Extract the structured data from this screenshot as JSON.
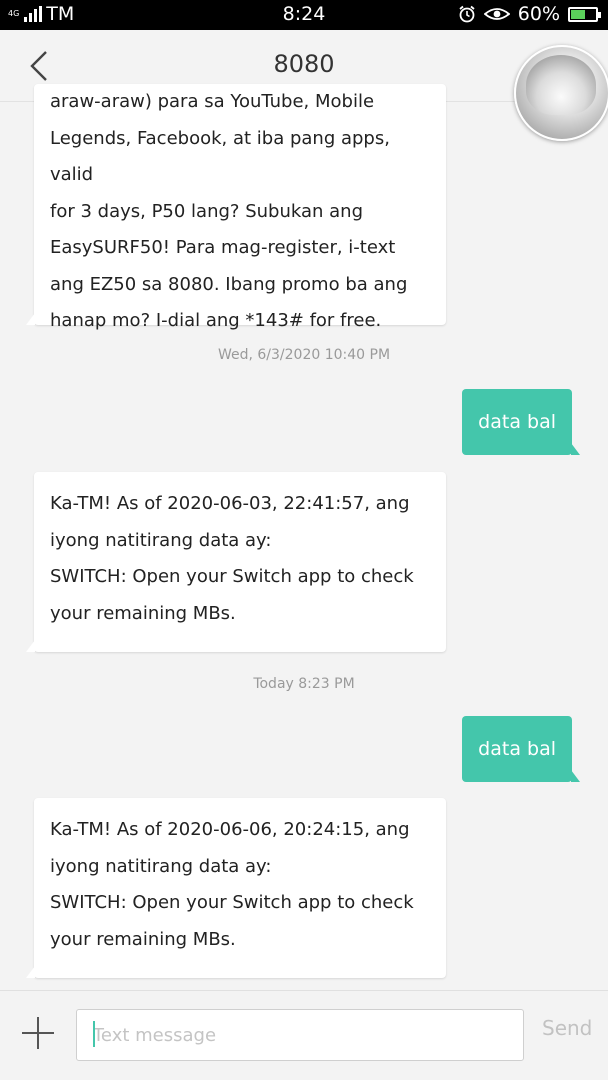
{
  "status_bar": {
    "network_type": "4G",
    "carrier": "TM",
    "time": "8:24",
    "battery": "60%",
    "battery_level": 0.6,
    "icons": [
      "alarm-icon",
      "eye-comfort-icon",
      "battery-icon"
    ]
  },
  "header": {
    "title": "8080",
    "back_icon": "chevron-left-icon"
  },
  "messages": [
    {
      "direction": "incoming",
      "text": "araw-araw) para sa YouTube, Mobile\nLegends, Facebook, at iba pang apps, valid\nfor 3 days, P50 lang? Subukan ang\nEasySURF50! Para mag-register, i-text\nang EZ50 sa 8080. Ibang promo ba ang\nhanap mo? I-dial ang *143# for free."
    },
    {
      "type": "timestamp",
      "text": "Wed, 6/3/2020 10:40 PM"
    },
    {
      "direction": "outgoing",
      "text": "data bal"
    },
    {
      "direction": "incoming",
      "text": "Ka-TM! As of 2020-06-03, 22:41:57, ang\niyong natitirang data ay:\nSWITCH: Open your Switch app to check\nyour remaining MBs."
    },
    {
      "type": "timestamp",
      "text": "Today 8:23 PM"
    },
    {
      "direction": "outgoing",
      "text": "data bal"
    },
    {
      "direction": "incoming",
      "text": "Ka-TM! As of 2020-06-06, 20:24:15, ang\niyong natitirang data ay:\nSWITCH: Open your Switch app to check\nyour remaining MBs."
    }
  ],
  "composer": {
    "placeholder": "Text message",
    "send_label": "Send"
  },
  "colors": {
    "accent": "#44c6ab",
    "background": "#f3f3f3",
    "incoming_bubble": "#ffffff"
  }
}
